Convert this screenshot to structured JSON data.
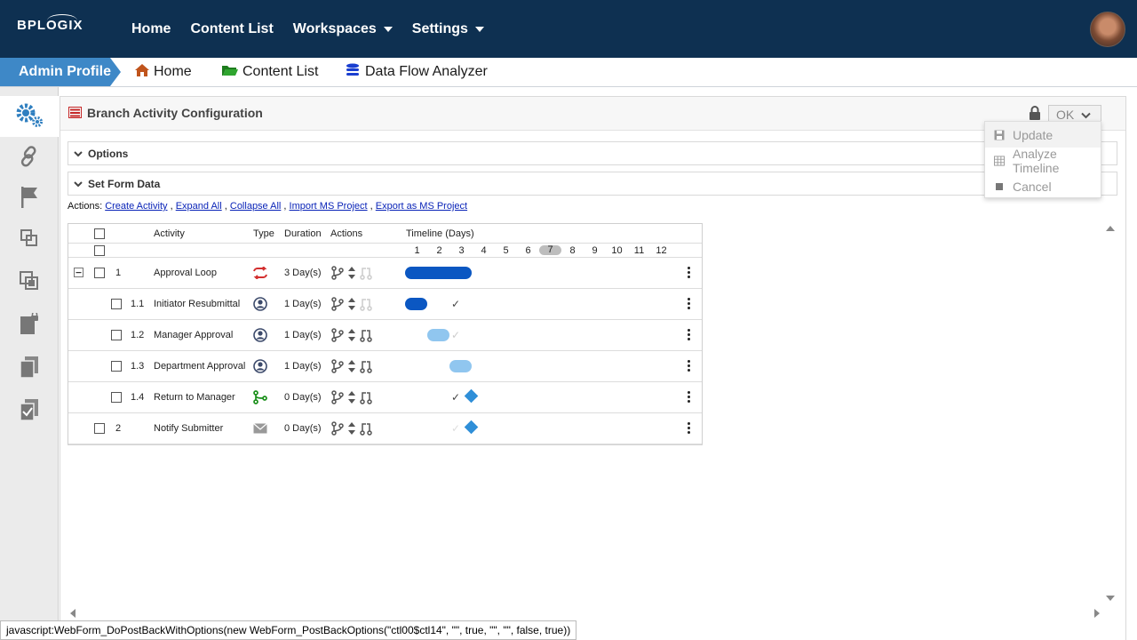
{
  "brand": {
    "logo_text": "BPLOGIX"
  },
  "nav": {
    "home": "Home",
    "content_list": "Content List",
    "workspaces": "Workspaces",
    "settings": "Settings"
  },
  "breadcrumb": {
    "admin": "Admin Profile",
    "home": "Home",
    "content_list": "Content List",
    "data_flow": "Data Flow Analyzer"
  },
  "panel": {
    "title": "Branch Activity Configuration",
    "ok_label": "OK"
  },
  "sections": {
    "options": "Options",
    "set_form_data": "Set Form Data"
  },
  "actions": {
    "prefix": "Actions:",
    "create": "Create Activity",
    "expand": "Expand All",
    "collapse": "Collapse All",
    "import": "Import MS Project",
    "export": "Export as MS Project",
    "sep": ","
  },
  "grid": {
    "headers": {
      "activity": "Activity",
      "type": "Type",
      "duration": "Duration",
      "actions": "Actions",
      "timeline": "Timeline (Days)"
    },
    "days": [
      "1",
      "2",
      "3",
      "4",
      "5",
      "6",
      "7",
      "8",
      "9",
      "10",
      "11",
      "12"
    ],
    "today_day": "7",
    "rows": [
      {
        "num": "1",
        "activity": "Approval Loop",
        "duration": "3 Day(s)",
        "type_icon": "loop-icon"
      },
      {
        "num": "1.1",
        "activity": "Initiator Resubmittal",
        "duration": "1 Day(s)",
        "type_icon": "user-icon"
      },
      {
        "num": "1.2",
        "activity": "Manager Approval",
        "duration": "1 Day(s)",
        "type_icon": "user-icon"
      },
      {
        "num": "1.3",
        "activity": "Department Approval",
        "duration": "1 Day(s)",
        "type_icon": "user-icon"
      },
      {
        "num": "1.4",
        "activity": "Return to Manager",
        "duration": "0 Day(s)",
        "type_icon": "branch-icon"
      },
      {
        "num": "2",
        "activity": "Notify Submitter",
        "duration": "0 Day(s)",
        "type_icon": "mail-icon"
      }
    ]
  },
  "menu": {
    "update": "Update",
    "analyze": "Analyze Timeline",
    "cancel": "Cancel"
  },
  "status": {
    "text": "javascript:WebForm_DoPostBackWithOptions(new WebForm_PostBackOptions(\"ctl00$ctl14\", \"\", true, \"\", \"\", false, true))"
  },
  "colors": {
    "topbar": "#0e3051",
    "admin": "#3e88c7",
    "bar_dark": "#0b57c2",
    "bar_light": "#90c6ef",
    "milestone": "#2f8fd8"
  }
}
